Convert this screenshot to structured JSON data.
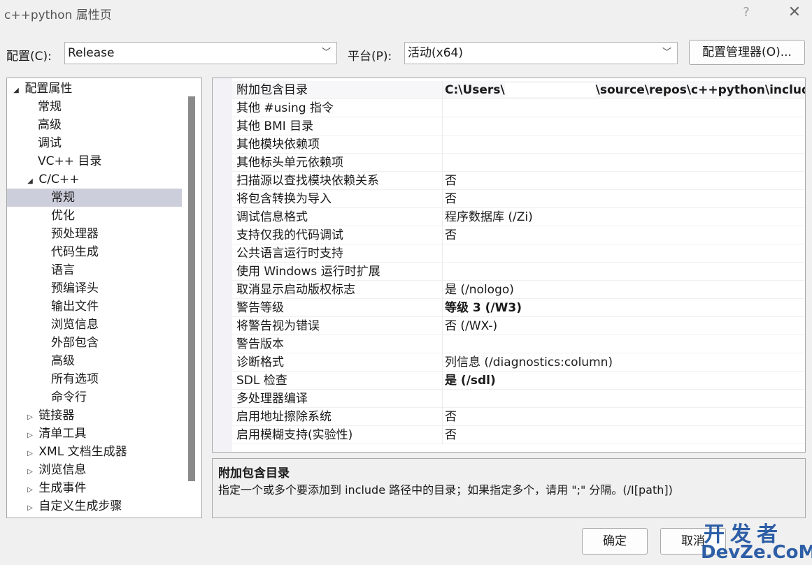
{
  "window": {
    "title": "c++python 属性页",
    "help_label": "?",
    "close_label": "✕"
  },
  "toolbar": {
    "config_label": "配置(C):",
    "config_value": "Release",
    "platform_label": "平台(P):",
    "platform_value": "活动(x64)",
    "manager_button": "配置管理器(O)..."
  },
  "tree": {
    "items": [
      {
        "label": "配置属性",
        "expander": "◢"
      },
      {
        "label": "常规"
      },
      {
        "label": "高级"
      },
      {
        "label": "调试"
      },
      {
        "label": "VC++ 目录"
      },
      {
        "label": "C/C++",
        "expander": "◢"
      },
      {
        "label": "常规",
        "selected": true
      },
      {
        "label": "优化"
      },
      {
        "label": "预处理器"
      },
      {
        "label": "代码生成"
      },
      {
        "label": "语言"
      },
      {
        "label": "预编译头"
      },
      {
        "label": "输出文件"
      },
      {
        "label": "浏览信息"
      },
      {
        "label": "外部包含"
      },
      {
        "label": "高级"
      },
      {
        "label": "所有选项"
      },
      {
        "label": "命令行"
      },
      {
        "label": "链接器",
        "expander": "▷"
      },
      {
        "label": "清单工具",
        "expander": "▷"
      },
      {
        "label": "XML 文档生成器",
        "expander": "▷"
      },
      {
        "label": "浏览信息",
        "expander": "▷"
      },
      {
        "label": "生成事件",
        "expander": "▷"
      },
      {
        "label": "自定义生成步骤",
        "expander": "▷"
      }
    ]
  },
  "properties": {
    "rows": [
      {
        "name": "附加包含目录",
        "value_prefix": "C:\\Users\\",
        "value_suffix": "\\source\\repos\\c++python\\include",
        "bold": true
      },
      {
        "name": "其他 #using 指令",
        "value": ""
      },
      {
        "name": "其他 BMI 目录",
        "value": ""
      },
      {
        "name": "其他模块依赖项",
        "value": ""
      },
      {
        "name": "其他标头单元依赖项",
        "value": ""
      },
      {
        "name": "扫描源以查找模块依赖关系",
        "value": "否"
      },
      {
        "name": "将包含转换为导入",
        "value": "否"
      },
      {
        "name": "调试信息格式",
        "value": "程序数据库 (/Zi)"
      },
      {
        "name": "支持仅我的代码调试",
        "value": "否"
      },
      {
        "name": "公共语言运行时支持",
        "value": ""
      },
      {
        "name": "使用 Windows 运行时扩展",
        "value": ""
      },
      {
        "name": "取消显示启动版权标志",
        "value": "是 (/nologo)"
      },
      {
        "name": "警告等级",
        "value": "等级 3 (/W3)",
        "bold": true
      },
      {
        "name": "将警告视为错误",
        "value": "否 (/WX-)"
      },
      {
        "name": "警告版本",
        "value": ""
      },
      {
        "name": "诊断格式",
        "value": "列信息 (/diagnostics:column)"
      },
      {
        "name": "SDL 检查",
        "value": "是 (/sdl)",
        "bold": true
      },
      {
        "name": "多处理器编译",
        "value": ""
      },
      {
        "name": "启用地址擦除系统",
        "value": "否"
      },
      {
        "name": "启用模糊支持(实验性)",
        "value": "否"
      }
    ]
  },
  "description": {
    "title": "附加包含目录",
    "body": "指定一个或多个要添加到 include 路径中的目录；如果指定多个，请用 \";\" 分隔。(/I[path])"
  },
  "buttons": {
    "ok": "确定",
    "cancel": "取消"
  },
  "watermark": {
    "top": "开发者",
    "bottom": "DevZe.CoM"
  }
}
